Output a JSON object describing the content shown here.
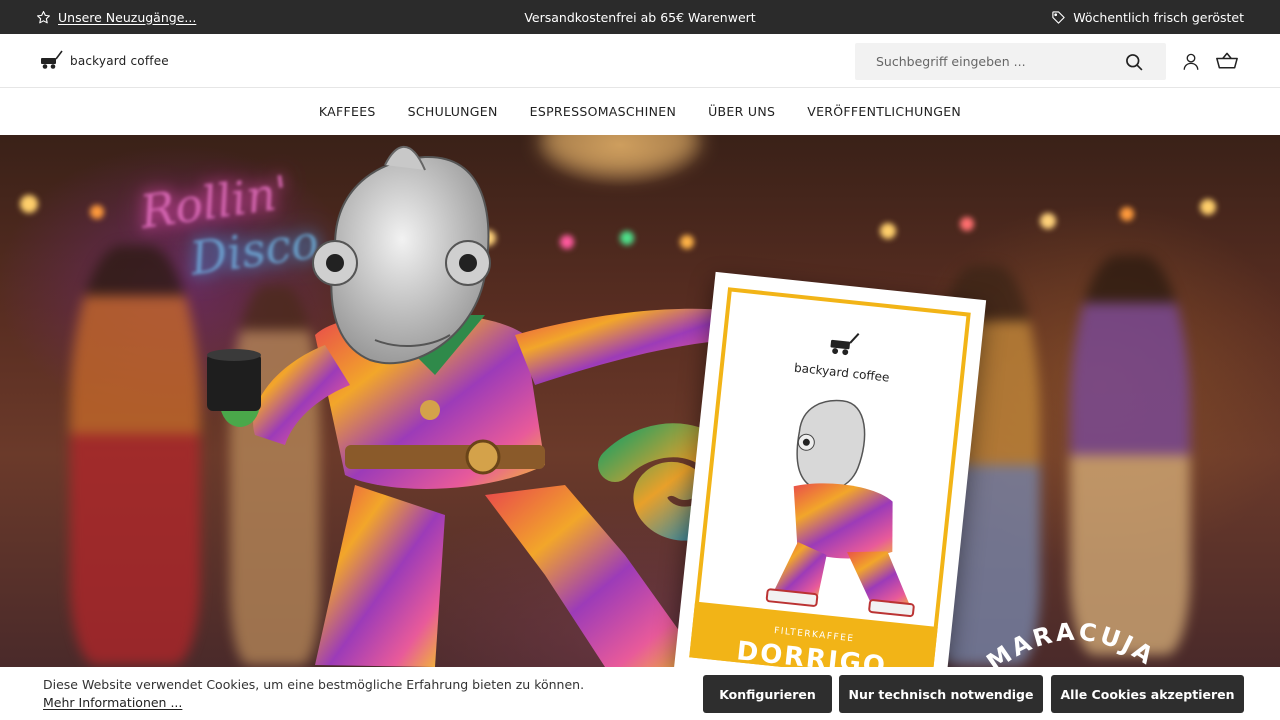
{
  "announcement": {
    "left_link": "Unsere Neuzugänge...",
    "center_text": "Versandkostenfrei ab 65€ Warenwert",
    "right_text": "Wöchentlich frisch geröstet"
  },
  "header": {
    "brand": "backyard coffee",
    "search_placeholder": "Suchbegriff eingeben ..."
  },
  "nav": {
    "items": [
      "KAFFEES",
      "SCHULUNGEN",
      "ESPRESSOMASCHINEN",
      "ÜBER UNS",
      "VERÖFFENTLICHUNGEN"
    ]
  },
  "hero": {
    "neon_line1": "Rollin'",
    "neon_line2": "Disco",
    "package_brand": "backyard coffee",
    "package_type": "FILTERKAFFEE",
    "package_name": "DORRIGO",
    "badge_text": "MARACUJA"
  },
  "cookie": {
    "message": "Diese Website verwendet Cookies, um eine bestmögliche Erfahrung bieten zu können.",
    "more_link": "Mehr Informationen ...",
    "buttons": {
      "configure": "Konfigurieren",
      "necessary": "Nur technisch notwendige",
      "accept_all": "Alle Cookies akzeptieren"
    }
  },
  "colors": {
    "topbar_bg": "#2b2b2b",
    "button_bg": "#2e2e2e",
    "package_accent": "#f2b417"
  },
  "icons": {
    "announcement_left": "star-icon",
    "announcement_right": "tag-icon",
    "search": "search-icon",
    "account": "user-icon",
    "cart": "basket-icon",
    "logo": "wagon-icon"
  }
}
